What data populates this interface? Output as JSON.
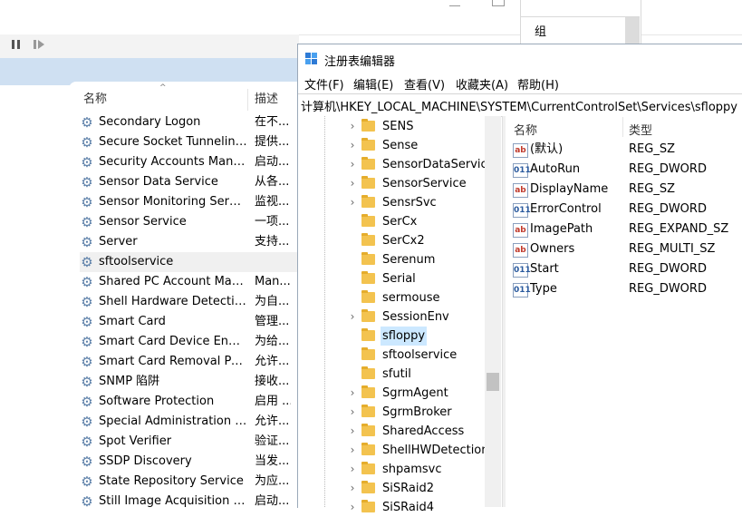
{
  "services": {
    "header_name": "名称",
    "header_desc": "描述",
    "rows": [
      {
        "name": "Secondary Logon",
        "desc": "在不..."
      },
      {
        "name": "Secure Socket Tunneling ...",
        "desc": "提供..."
      },
      {
        "name": "Security Accounts Manag...",
        "desc": "启动..."
      },
      {
        "name": "Sensor Data Service",
        "desc": "从各..."
      },
      {
        "name": "Sensor Monitoring Service",
        "desc": "监视..."
      },
      {
        "name": "Sensor Service",
        "desc": "一项..."
      },
      {
        "name": "Server",
        "desc": "支持..."
      },
      {
        "name": "sftoolservice",
        "desc": ""
      },
      {
        "name": "Shared PC Account Mana...",
        "desc": "Man..."
      },
      {
        "name": "Shell Hardware Detection",
        "desc": "为自..."
      },
      {
        "name": "Smart Card",
        "desc": "管理..."
      },
      {
        "name": "Smart Card Device Enum...",
        "desc": "为给..."
      },
      {
        "name": "Smart Card Removal Poli...",
        "desc": "允许..."
      },
      {
        "name": "SNMP 陷阱",
        "desc": "接收..."
      },
      {
        "name": "Software Protection",
        "desc": "启用 ..."
      },
      {
        "name": "Special Administration C...",
        "desc": "允许..."
      },
      {
        "name": "Spot Verifier",
        "desc": "验证..."
      },
      {
        "name": "SSDP Discovery",
        "desc": "当发..."
      },
      {
        "name": "State Repository Service",
        "desc": "为应..."
      },
      {
        "name": "Still Image Acquisition Ev...",
        "desc": "启动..."
      }
    ]
  },
  "group_panel": {
    "label": "组"
  },
  "registry": {
    "title": "注册表编辑器",
    "menu": [
      "文件(F)",
      "编辑(E)",
      "查看(V)",
      "收藏夹(A)",
      "帮助(H)"
    ],
    "address": "计算机\\HKEY_LOCAL_MACHINE\\SYSTEM\\CurrentControlSet\\Services\\sfloppy",
    "tree": [
      {
        "label": "SENS",
        "expand": true
      },
      {
        "label": "Sense",
        "expand": true
      },
      {
        "label": "SensorDataService",
        "expand": true
      },
      {
        "label": "SensorService",
        "expand": true
      },
      {
        "label": "SensrSvc",
        "expand": true
      },
      {
        "label": "SerCx",
        "expand": false
      },
      {
        "label": "SerCx2",
        "expand": false
      },
      {
        "label": "Serenum",
        "expand": false
      },
      {
        "label": "Serial",
        "expand": false
      },
      {
        "label": "sermouse",
        "expand": false
      },
      {
        "label": "SessionEnv",
        "expand": true
      },
      {
        "label": "sfloppy",
        "expand": false,
        "selected": true
      },
      {
        "label": "sftoolservice",
        "expand": false
      },
      {
        "label": "sfutil",
        "expand": false
      },
      {
        "label": "SgrmAgent",
        "expand": true
      },
      {
        "label": "SgrmBroker",
        "expand": true
      },
      {
        "label": "SharedAccess",
        "expand": true
      },
      {
        "label": "ShellHWDetection",
        "expand": true
      },
      {
        "label": "shpamsvc",
        "expand": true
      },
      {
        "label": "SiSRaid2",
        "expand": true
      },
      {
        "label": "SiSRaid4",
        "expand": true
      }
    ],
    "values_header": {
      "name": "名称",
      "type": "类型"
    },
    "values": [
      {
        "name": "(默认)",
        "type": "REG_SZ",
        "icon": "ab"
      },
      {
        "name": "AutoRun",
        "type": "REG_DWORD",
        "icon": "bin"
      },
      {
        "name": "DisplayName",
        "type": "REG_SZ",
        "icon": "ab"
      },
      {
        "name": "ErrorControl",
        "type": "REG_DWORD",
        "icon": "bin"
      },
      {
        "name": "ImagePath",
        "type": "REG_EXPAND_SZ",
        "icon": "ab"
      },
      {
        "name": "Owners",
        "type": "REG_MULTI_SZ",
        "icon": "ab"
      },
      {
        "name": "Start",
        "type": "REG_DWORD",
        "icon": "bin"
      },
      {
        "name": "Type",
        "type": "REG_DWORD",
        "icon": "bin"
      }
    ]
  }
}
